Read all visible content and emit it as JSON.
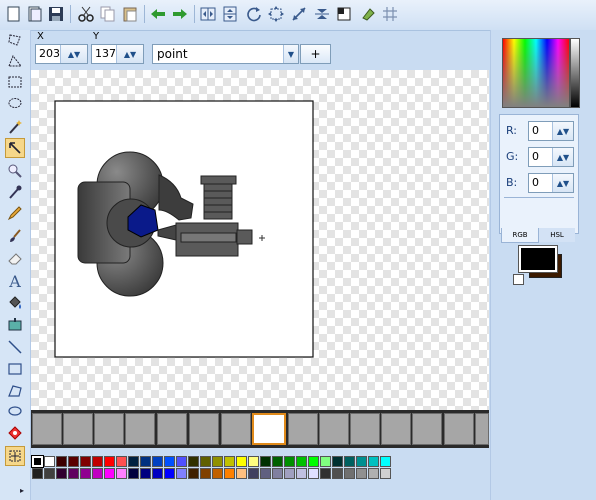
{
  "toolbar": {
    "icons": [
      "new-icon",
      "open-icon",
      "save-icon",
      "cut-icon",
      "copy-icon",
      "paste-icon",
      "undo-icon",
      "redo-icon",
      "flip-horizontal-icon",
      "flip-vertical-icon",
      "rotate-icon",
      "resize-icon",
      "stretch-icon",
      "center-icon",
      "crop-icon",
      "fill-icon",
      "grid-icon"
    ]
  },
  "tools": [
    "free-select-icon",
    "lasso-icon",
    "rectangle-select-icon",
    "ellipse-select-icon",
    "magic-wand-icon",
    "move-icon",
    "zoom-icon",
    "color-picker-icon",
    "pencil-icon",
    "brush-icon",
    "eraser-icon",
    "text-icon",
    "fill-bucket-icon",
    "dropper-icon",
    "line-icon",
    "rectangle-icon",
    "polygon-icon",
    "ellipse-icon",
    "hotspot-icon",
    "selection-frame-icon"
  ],
  "coords": {
    "x_label": "X",
    "x_value": "203",
    "y_label": "Y",
    "y_value": "137",
    "shape_value": "point",
    "add_label": "+"
  },
  "frames": {
    "count": 14,
    "selected_index": 7
  },
  "color_panel": {
    "r_label": "R:",
    "r_value": "0",
    "g_label": "G:",
    "g_value": "0",
    "b_label": "B:",
    "b_value": "0",
    "tab_rgb": "RGB",
    "tab_hsl": "HSL",
    "foreground": "#000000",
    "background": "#3b1a00"
  },
  "palette_row1": [
    "#000000",
    "#ffffff",
    "#3b0000",
    "#5a0000",
    "#800000",
    "#c00000",
    "#ff0000",
    "#ff5050",
    "#002040",
    "#003080",
    "#0040c0",
    "#0050ff",
    "#5050ff",
    "#303000",
    "#606000",
    "#909000",
    "#c0c000",
    "#ffff00",
    "#ffff80",
    "#003000",
    "#006000",
    "#009000",
    "#00c000",
    "#00ff00",
    "#80ff80",
    "#003030",
    "#006060",
    "#009090",
    "#00c0c0",
    "#00ffff"
  ],
  "palette_row2": [
    "#202020",
    "#404040",
    "#300030",
    "#600060",
    "#900090",
    "#c000c0",
    "#ff00ff",
    "#ff80ff",
    "#000040",
    "#000080",
    "#0000c0",
    "#0000ff",
    "#8080ff",
    "#402000",
    "#804000",
    "#c06000",
    "#ff8000",
    "#ffc080",
    "#404060",
    "#606080",
    "#8080a0",
    "#a0a0c0",
    "#c0c0e0",
    "#e0e0ff",
    "#303030",
    "#505050",
    "#707070",
    "#909090",
    "#b0b0b0",
    "#d0d0d0"
  ]
}
